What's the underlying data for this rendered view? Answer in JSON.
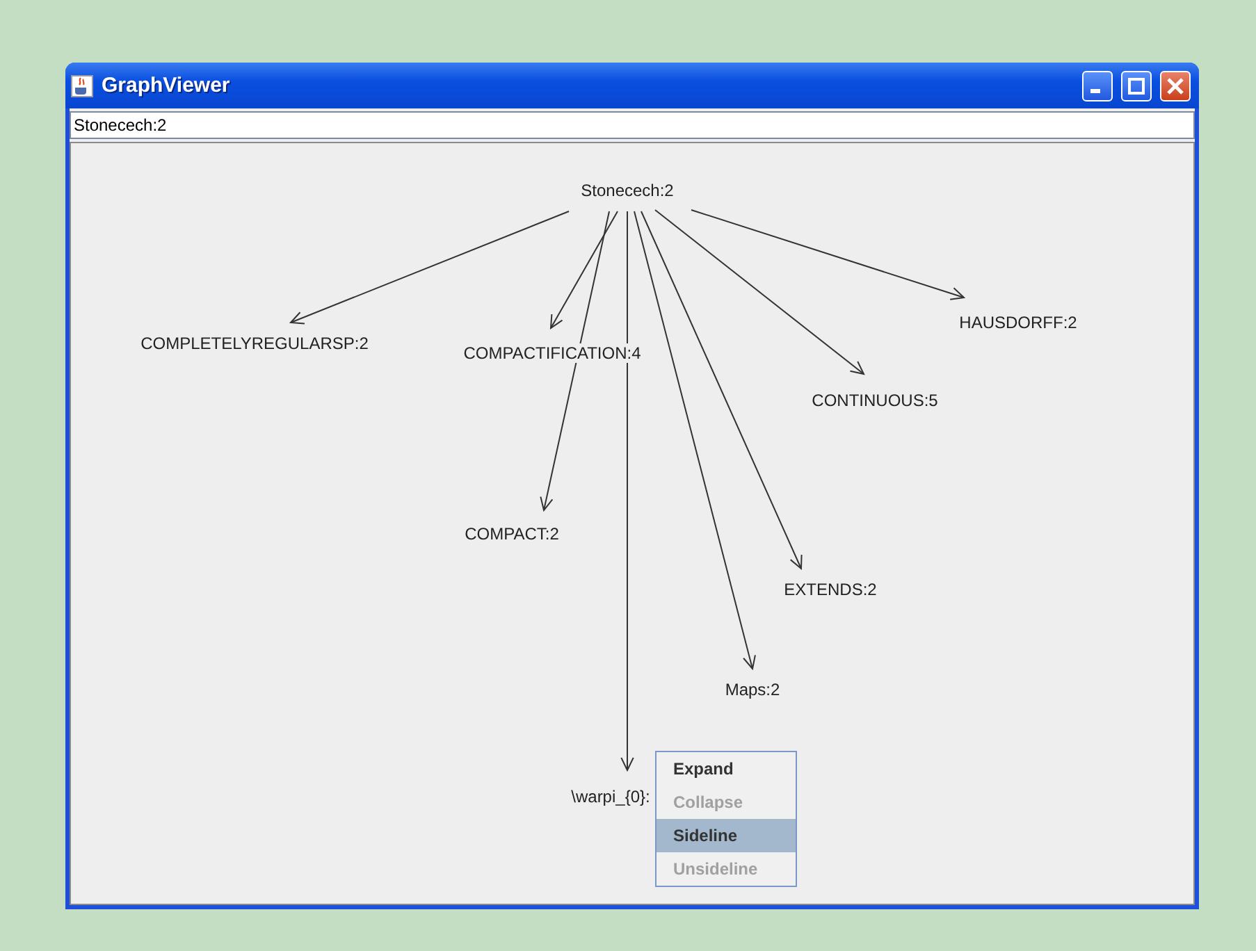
{
  "window": {
    "title": "GraphViewer"
  },
  "selection_field": {
    "value": "Stonecech:2"
  },
  "graph": {
    "root": {
      "label": "Stonecech:2"
    },
    "nodes": [
      {
        "label": "COMPLETELYREGULARSP:2"
      },
      {
        "label": "COMPACTIFICATION:4"
      },
      {
        "label": "HAUSDORFF:2"
      },
      {
        "label": "CONTINUOUS:5"
      },
      {
        "label": "COMPACT:2"
      },
      {
        "label": "EXTENDS:2"
      },
      {
        "label": "Maps:2"
      },
      {
        "label": "\\warpi_{0}:"
      }
    ]
  },
  "context_menu": {
    "items": [
      {
        "label": "Expand",
        "disabled": false,
        "selected": false
      },
      {
        "label": "Collapse",
        "disabled": true,
        "selected": false
      },
      {
        "label": "Sideline",
        "disabled": false,
        "selected": true
      },
      {
        "label": "Unsideline",
        "disabled": true,
        "selected": false
      }
    ]
  }
}
